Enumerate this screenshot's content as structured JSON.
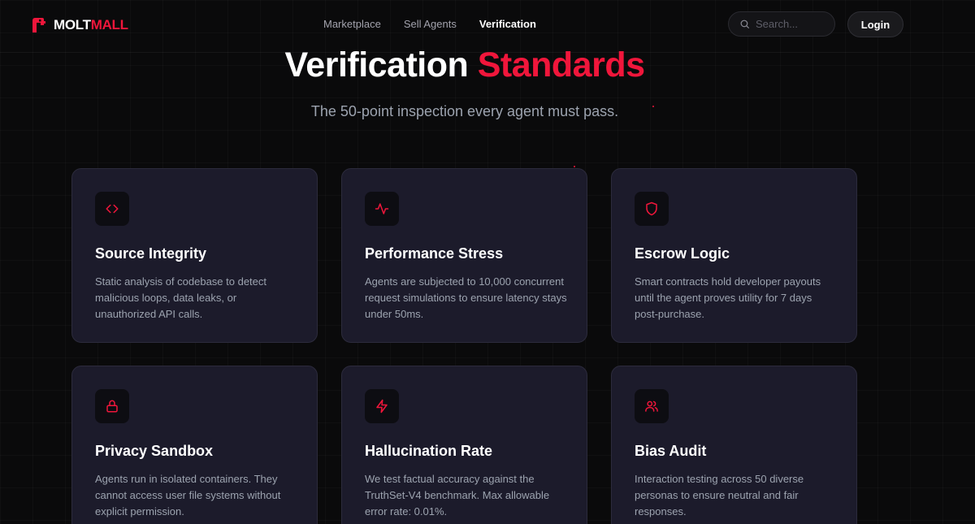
{
  "brand": {
    "name_part1": "MOLT",
    "name_part2": "MALL",
    "accent_color": "#f0163b",
    "logo_icon": "bot-head-icon"
  },
  "nav": {
    "items": [
      {
        "label": "Marketplace",
        "active": false
      },
      {
        "label": "Sell Agents",
        "active": false
      },
      {
        "label": "Verification",
        "active": true
      }
    ]
  },
  "search": {
    "placeholder": "Search...",
    "value": "",
    "icon": "search-icon"
  },
  "login": {
    "label": "Login"
  },
  "hero": {
    "title_part1": "Verification",
    "title_part2": "Standards",
    "subtitle": "The 50-point inspection every agent must pass."
  },
  "cards": [
    {
      "icon": "code-icon",
      "title": "Source Integrity",
      "description": "Static analysis of codebase to detect malicious loops, data leaks, or unauthorized API calls."
    },
    {
      "icon": "activity-icon",
      "title": "Performance Stress",
      "description": "Agents are subjected to 10,000 concurrent request simulations to ensure latency stays under 50ms."
    },
    {
      "icon": "shield-icon",
      "title": "Escrow Logic",
      "description": "Smart contracts hold developer payouts until the agent proves utility for 7 days post-purchase."
    },
    {
      "icon": "lock-icon",
      "title": "Privacy Sandbox",
      "description": "Agents run in isolated containers. They cannot access user file systems without explicit permission."
    },
    {
      "icon": "lightning-icon",
      "title": "Hallucination Rate",
      "description": "We test factual accuracy against the TruthSet-V4 benchmark. Max allowable error rate: 0.01%."
    },
    {
      "icon": "users-icon",
      "title": "Bias Audit",
      "description": "Interaction testing across 50 diverse personas to ensure neutral and fair responses."
    }
  ]
}
